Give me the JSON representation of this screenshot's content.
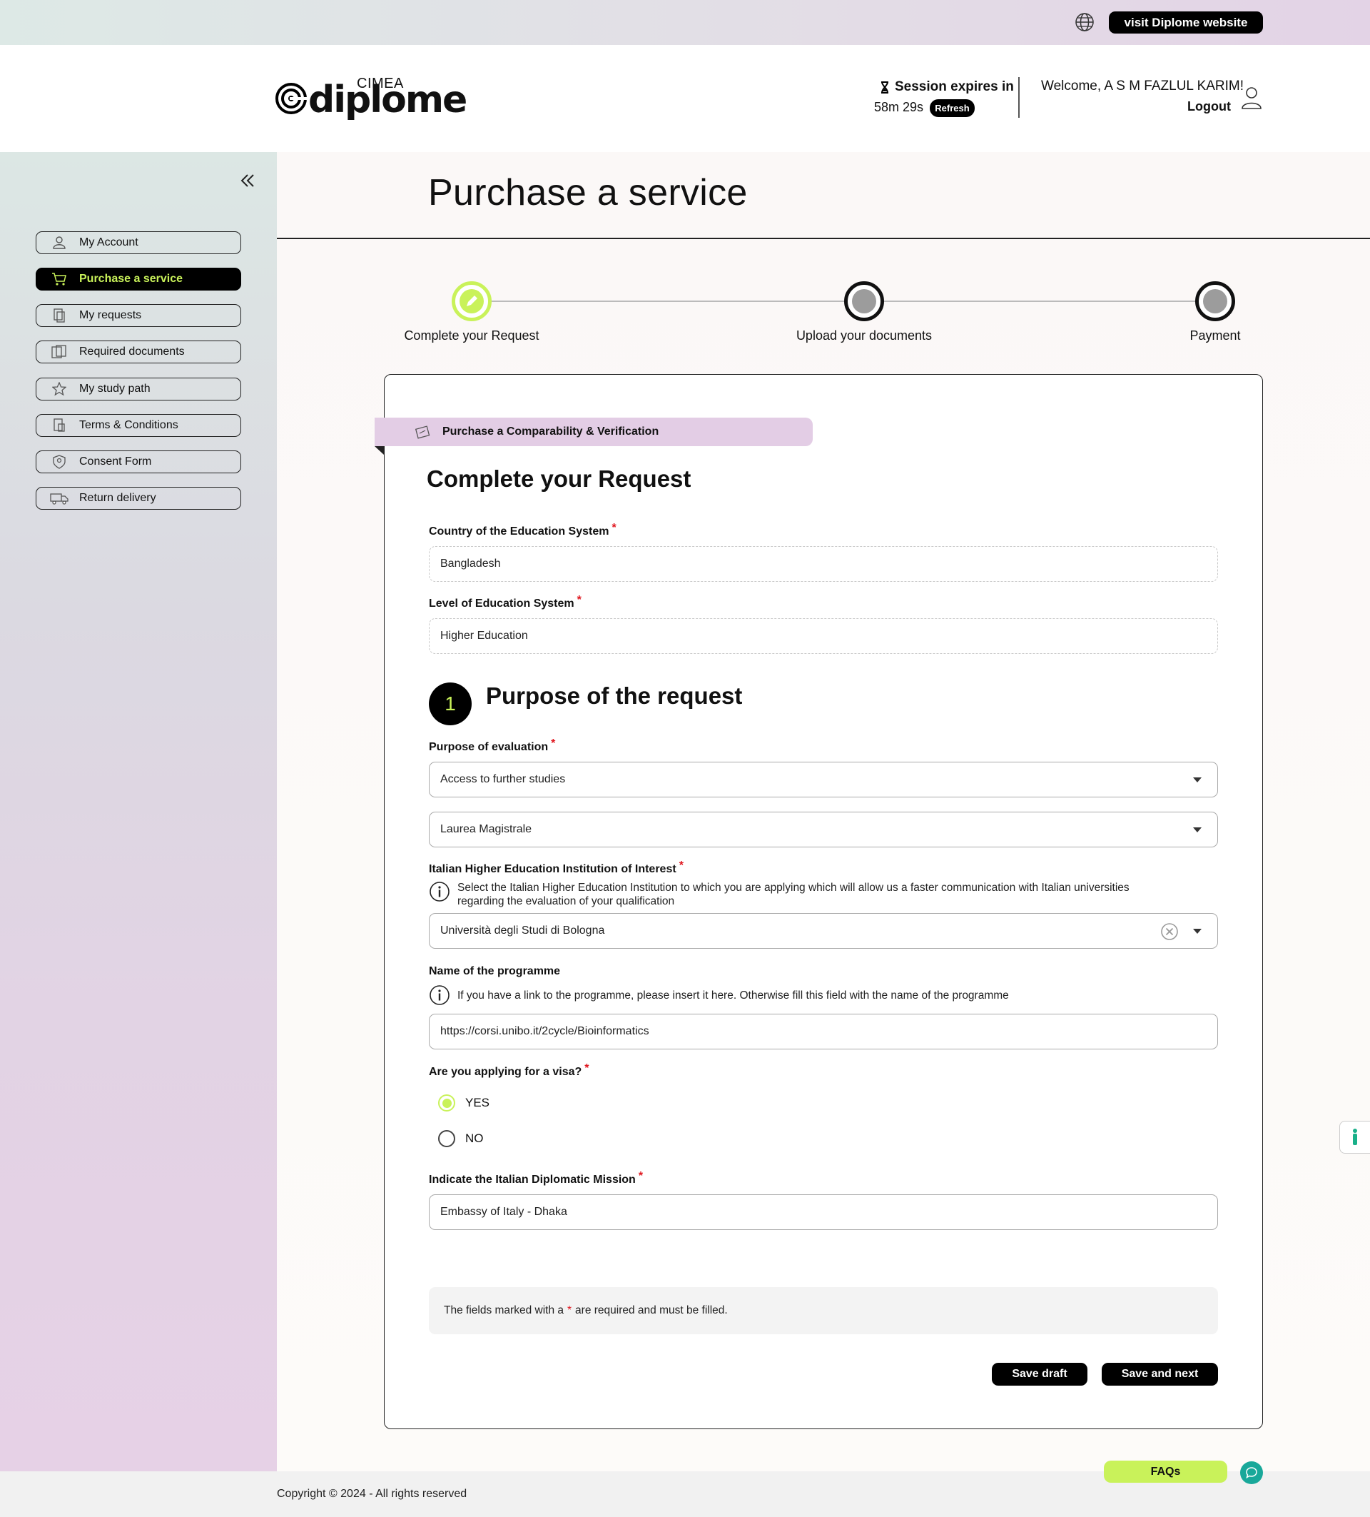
{
  "topbar": {
    "visit_label": "visit Diplome website"
  },
  "header": {
    "logo_small": "CIMEA",
    "logo_word": "diplome",
    "session_title": "Session expires in",
    "session_time": "58m 29s",
    "refresh_label": "Refresh",
    "welcome": "Welcome, A S M FAZLUL KARIM!",
    "logout": "Logout"
  },
  "sidebar": {
    "items": [
      {
        "label": "My Account",
        "icon": "user-icon"
      },
      {
        "label": "Purchase a service",
        "icon": "cart-icon",
        "active": true
      },
      {
        "label": "My requests",
        "icon": "requests-icon"
      },
      {
        "label": "Required documents",
        "icon": "documents-icon"
      },
      {
        "label": "My study path",
        "icon": "star-icon"
      },
      {
        "label": "Terms & Conditions",
        "icon": "terms-icon"
      },
      {
        "label": "Consent Form",
        "icon": "consent-icon"
      },
      {
        "label": "Return delivery",
        "icon": "truck-icon"
      }
    ]
  },
  "page": {
    "title": "Purchase a service"
  },
  "stepper": {
    "steps": [
      {
        "label": "Complete your Request",
        "status": "current"
      },
      {
        "label": "Upload your documents",
        "status": "pending"
      },
      {
        "label": "Payment",
        "status": "pending"
      }
    ]
  },
  "card": {
    "ribbon": "Purchase a Comparability & Verification",
    "heading": "Complete your Request",
    "country_label": "Country of the Education System",
    "country_value": "Bangladesh",
    "level_label": "Level of Education System",
    "level_value": "Higher Education",
    "section_number": "1",
    "section_title": "Purpose of the request",
    "purpose_label": "Purpose of evaluation",
    "purpose_value": "Access to further studies",
    "degree_value": "Laurea Magistrale",
    "institution_label": "Italian Higher Education Institution of Interest",
    "institution_info": "Select the Italian Higher Education Institution to which you are applying which will allow us a faster communication with Italian universities regarding the evaluation of your qualification",
    "institution_value": "Università degli Studi di Bologna",
    "programme_label": "Name of the programme",
    "programme_info": "If you have a link to the programme, please insert it here. Otherwise fill this field with the name of the programme",
    "programme_value": "https://corsi.unibo.it/2cycle/Bioinformatics",
    "visa_label": "Are you applying for a visa?",
    "visa_yes": "YES",
    "visa_no": "NO",
    "visa_selected": "YES",
    "mission_label": "Indicate the Italian Diplomatic Mission",
    "mission_value": "Embassy of Italy - Dhaka",
    "note_before": "The fields marked with a",
    "note_star": "*",
    "note_after": "are required and must be filled.",
    "save_draft": "Save draft",
    "save_next": "Save and next"
  },
  "footer": {
    "copyright": "Copyright © 2024 - All rights reserved",
    "faq_label": "FAQs"
  },
  "colors": {
    "accent": "#c9f25a",
    "required": "#e0161e",
    "ribbon": "#e3cde5",
    "chat": "#19a89a"
  }
}
